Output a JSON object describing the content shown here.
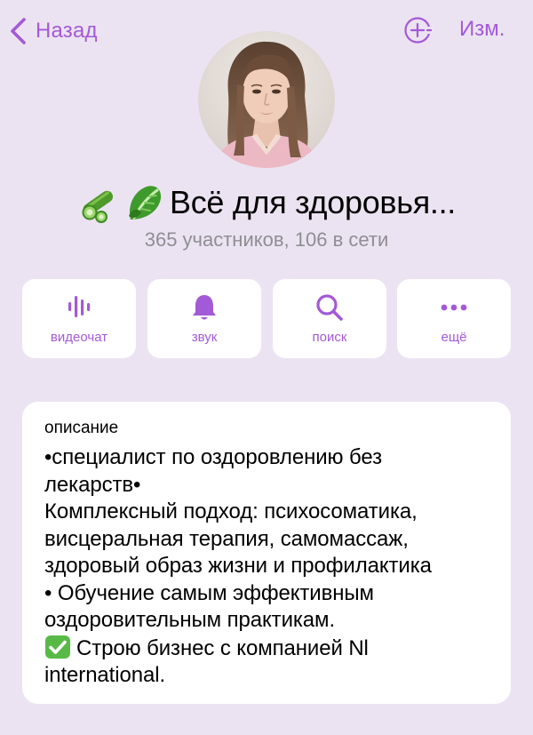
{
  "nav": {
    "back_label": "Назад",
    "edit_label": "Изм."
  },
  "profile": {
    "title": "Всё для здоровья...",
    "title_emojis": [
      "cucumber-emoji",
      "leafy-green-emoji"
    ],
    "subtitle": "365 участников, 106 в сети"
  },
  "actions": [
    {
      "label": "видеочат",
      "icon": "voice-chat-icon"
    },
    {
      "label": "звук",
      "icon": "bell-icon"
    },
    {
      "label": "поиск",
      "icon": "search-icon"
    },
    {
      "label": "ещё",
      "icon": "more-icon"
    }
  ],
  "description": {
    "label": "описание",
    "lines": [
      "•специалист по оздоровлению без",
      "лекарств•",
      "Комплексный подход: психосоматика,",
      "висцеральная терапия, самомассаж,",
      "здоровый образ жизни и профилактика",
      "• Обучение самым эффективным",
      "оздоровительным практикам.",
      "Строю бизнес с компанией Nl",
      "international."
    ]
  },
  "colors": {
    "accent": "#a35ad6",
    "background": "#ece3f2",
    "card": "#ffffff",
    "secondary_text": "#8e8e93"
  }
}
